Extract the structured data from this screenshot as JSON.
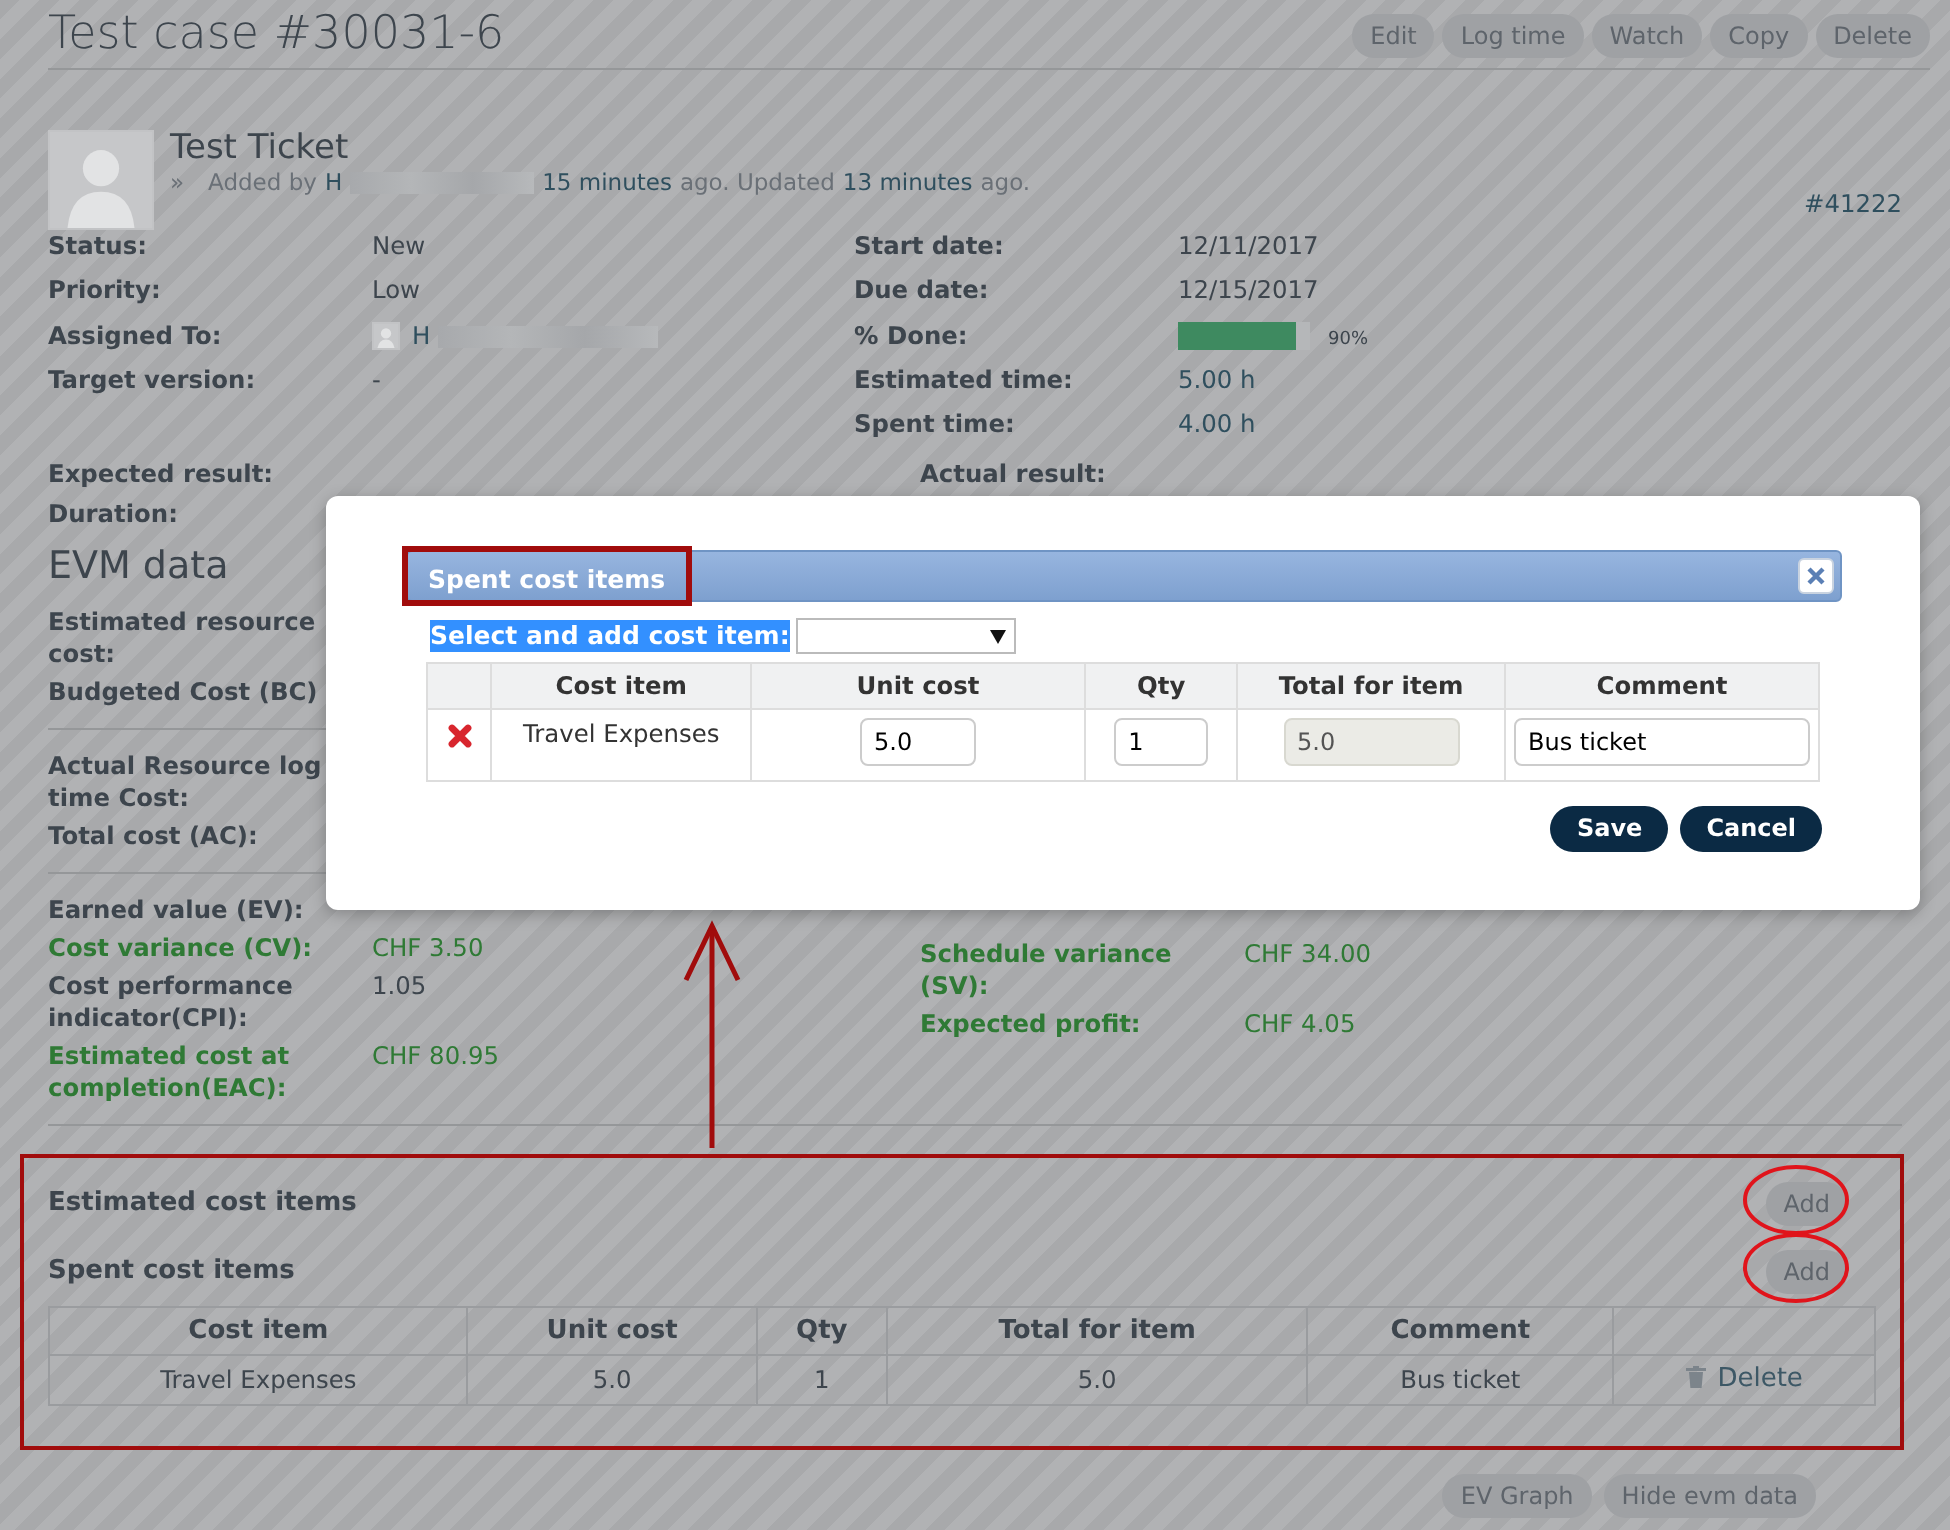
{
  "title": "Test case #30031-6",
  "actions": [
    "Edit",
    "Log time",
    "Watch",
    "Copy",
    "Delete"
  ],
  "issue": {
    "subject": "Test Ticket",
    "bullet": "»",
    "meta": [
      {
        "kind": "plain",
        "text": "Added by"
      },
      {
        "kind": "link",
        "text": "H"
      },
      {
        "kind": "redacted"
      },
      {
        "kind": "link",
        "text": "15 minutes"
      },
      {
        "kind": "plain",
        "text": "ago. Updated"
      },
      {
        "kind": "link",
        "text": "13 minutes"
      },
      {
        "kind": "plain",
        "text": "ago."
      }
    ],
    "number": "#41222"
  },
  "attributes_left": [
    {
      "kind": "text",
      "label": "Status:",
      "value": "New"
    },
    {
      "kind": "text",
      "label": "Priority:",
      "value": "Low"
    },
    {
      "kind": "user",
      "label": "Assigned To:",
      "value": "H"
    },
    {
      "kind": "text",
      "label": "Target version:",
      "value": "-"
    }
  ],
  "attributes_right": [
    {
      "kind": "text",
      "label": "Start date:",
      "value": "12/11/2017"
    },
    {
      "kind": "text",
      "label": "Due date:",
      "value": "12/15/2017"
    },
    {
      "kind": "progress",
      "label": "% Done:",
      "level": 0.9,
      "value": "90%"
    },
    {
      "kind": "link",
      "label": "Estimated time:",
      "value": "5.00 h"
    },
    {
      "kind": "link",
      "label": "Spent time:",
      "value": "4.00 h"
    }
  ],
  "results": [
    "Expected result:",
    "Actual result:"
  ],
  "duration": "Duration:",
  "evm": {
    "heading": "EVM data",
    "sections": [
      {
        "left": [
          {
            "label": "Estimated resource cost:",
            "positive": false
          },
          {
            "label": "Budgeted Cost (BC)",
            "positive": false
          }
        ]
      },
      {
        "left": [
          {
            "label": "Actual Resource log time Cost:",
            "positive": false
          },
          {
            "label": "Total cost (AC):",
            "positive": false
          }
        ]
      },
      {
        "left": [
          {
            "label": "Earned value (EV):",
            "positive": false
          },
          {
            "label": "Cost variance (CV):",
            "value": "CHF 3.50",
            "positive": true
          },
          {
            "label": "Cost performance indicator(CPI):",
            "value": "1.05",
            "positive": false
          },
          {
            "label": "Estimated cost at completion(EAC):",
            "value": "CHF 80.95",
            "positive": true
          }
        ],
        "right": [
          {
            "label": "Schedule variance (SV):",
            "value": "CHF 34.00",
            "positive": true
          },
          {
            "label": "Expected profit:",
            "value": "CHF 4.05",
            "positive": true
          }
        ]
      }
    ]
  },
  "cost_sections": [
    {
      "title": "Estimated cost items",
      "add": "Add"
    },
    {
      "title": "Spent cost items",
      "add": "Add",
      "table": {
        "columns": [
          "Cost item",
          "Unit cost",
          "Qty",
          "Total for item",
          "Comment"
        ],
        "rows": [
          {
            "cells": [
              "Travel Expenses",
              "5.0",
              "1",
              "5.0",
              "Bus ticket"
            ],
            "action": "Delete"
          }
        ]
      }
    }
  ],
  "footer_buttons": [
    "EV Graph",
    "Hide evm data"
  ],
  "dialog": {
    "title": "Spent cost items",
    "select_label": "Select and add cost item:",
    "select_highlighted": true,
    "columns": [
      "Cost item",
      "Unit cost",
      "Qty",
      "Total for item",
      "Comment"
    ],
    "rows": [
      {
        "cost_item": "Travel Expenses",
        "unit_cost": "5.0",
        "qty": "1",
        "total": "5.0",
        "total_disabled": true,
        "comment": "Bus ticket"
      }
    ],
    "buttons": [
      "Save",
      "Cancel"
    ]
  }
}
